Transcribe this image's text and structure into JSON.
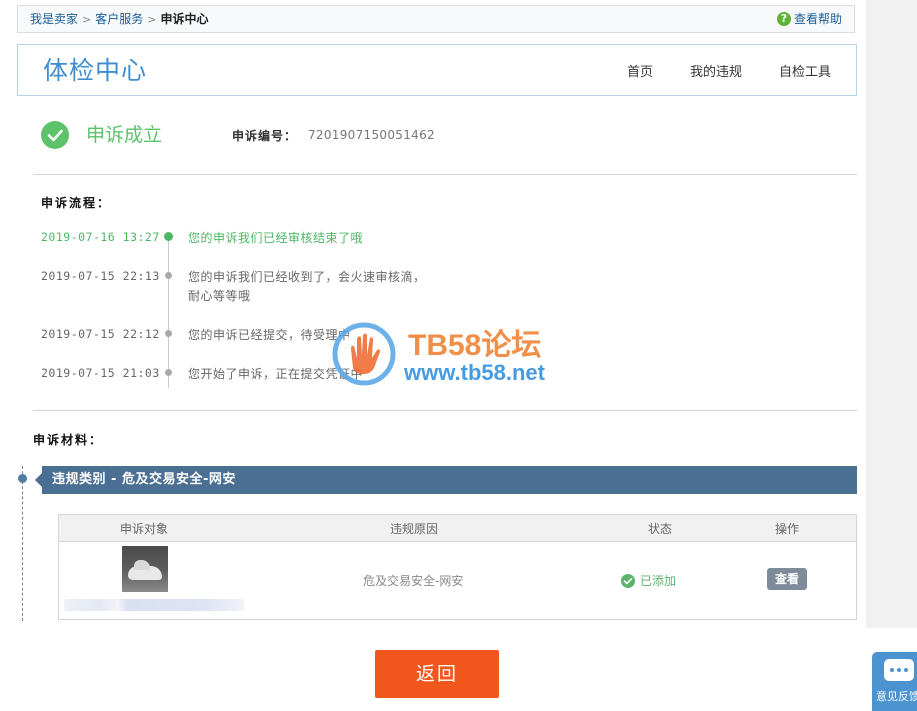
{
  "breadcrumb": {
    "items": [
      "我是卖家",
      "客户服务"
    ],
    "current": "申诉中心",
    "separator": ">",
    "help_label": "查看帮助",
    "help_icon": "?"
  },
  "header": {
    "title": "体检中心",
    "nav": [
      "首页",
      "我的违规",
      "自检工具"
    ]
  },
  "status": {
    "text": "申诉成立",
    "case_label": "申诉编号：",
    "case_number": "7201907150051462"
  },
  "process": {
    "title": "申诉流程：",
    "steps": [
      {
        "date": "2019-07-16 13:27",
        "message": "您的申诉我们已经审核结束了哦",
        "active": true
      },
      {
        "date": "2019-07-15 22:13",
        "message": "您的申诉我们已经收到了，会火速审核滴，耐心等等哦",
        "active": false
      },
      {
        "date": "2019-07-15 22:12",
        "message": "您的申诉已经提交，待受理中",
        "active": false
      },
      {
        "date": "2019-07-15 21:03",
        "message": "您开始了申诉，正在提交凭证中",
        "active": false
      }
    ]
  },
  "watermark": {
    "line1": "TB58论坛",
    "line2": "www.tb58.net"
  },
  "materials": {
    "title": "申诉材料：",
    "category": "违规类别 - 危及交易安全-网安",
    "table": {
      "headers": [
        "申诉对象",
        "违规原因",
        "状态",
        "操作"
      ],
      "rows": [
        {
          "reason": "危及交易安全-网安",
          "status": "已添加",
          "action": "查看"
        }
      ]
    }
  },
  "back_button": "返回",
  "feedback_label": "意见反馈",
  "colors": {
    "accent_blue": "#3e8ed0",
    "success_green": "#5cc36a",
    "category_bar": "#4a6f92",
    "back_button": "#f1561c"
  }
}
